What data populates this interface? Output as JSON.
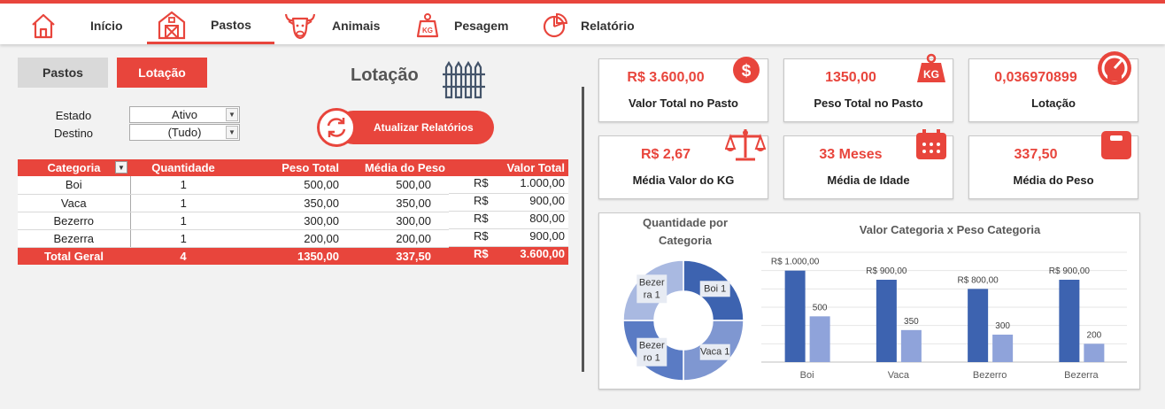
{
  "nav": {
    "items": [
      {
        "label": "Início"
      },
      {
        "label": "Pastos"
      },
      {
        "label": "Animais"
      },
      {
        "label": "Pesagem"
      },
      {
        "label": "Relatório"
      }
    ]
  },
  "buttons": {
    "pastos": "Pastos",
    "lotacao": "Lotação",
    "atualizar": "Atualizar Relatórios"
  },
  "section_title": "Lotação",
  "filters": {
    "estado_label": "Estado",
    "estado_value": "Ativo",
    "destino_label": "Destino",
    "destino_value": "(Tudo)"
  },
  "table": {
    "headers": [
      "Categoria",
      "Quantidade",
      "Peso Total",
      "Média do Peso",
      "Valor Total"
    ],
    "rows": [
      {
        "categoria": "Boi",
        "quantidade": "1",
        "peso": "500,00",
        "media": "500,00",
        "cur": "R$",
        "valor": "1.000,00"
      },
      {
        "categoria": "Vaca",
        "quantidade": "1",
        "peso": "350,00",
        "media": "350,00",
        "cur": "R$",
        "valor": "900,00"
      },
      {
        "categoria": "Bezerro",
        "quantidade": "1",
        "peso": "300,00",
        "media": "300,00",
        "cur": "R$",
        "valor": "800,00"
      },
      {
        "categoria": "Bezerra",
        "quantidade": "1",
        "peso": "200,00",
        "media": "200,00",
        "cur": "R$",
        "valor": "900,00"
      }
    ],
    "total": {
      "categoria": "Total Geral",
      "quantidade": "4",
      "peso": "1350,00",
      "media": "337,50",
      "cur": "R$",
      "valor": "3.600,00"
    }
  },
  "kpis": [
    {
      "value": "R$ 3.600,00",
      "label": "Valor Total no Pasto",
      "icon": "dollar-icon"
    },
    {
      "value": "1350,00",
      "label": "Peso Total no Pasto",
      "icon": "kg-weight-icon"
    },
    {
      "value": "0,036970899",
      "label": "Lotação",
      "icon": "gauge-icon"
    },
    {
      "value": "R$ 2,67",
      "label": "Média Valor do KG",
      "icon": "scale-icon"
    },
    {
      "value": "33 Meses",
      "label": "Média de Idade",
      "icon": "calendar-icon"
    },
    {
      "value": "337,50",
      "label": "Média do Peso",
      "icon": "weight-icon"
    }
  ],
  "colors": {
    "accent": "#e8453c",
    "pie": [
      "#3d63b0",
      "#7f97d1",
      "#5a7bc4",
      "#a9b9e1"
    ],
    "bar_value": "#3d63b0",
    "bar_weight": "#8fa3da"
  },
  "chart_data": [
    {
      "type": "pie",
      "title": "Quantidade por Categoria",
      "categories": [
        "Boi",
        "Vaca",
        "Bezerro",
        "Bezerra"
      ],
      "values": [
        1,
        1,
        1,
        1
      ],
      "labels": [
        "Boi 1",
        "Vaca 1",
        "Bezerro 1",
        "Bezerra 1"
      ]
    },
    {
      "type": "bar",
      "title": "Valor Categoria x Peso Categoria",
      "categories": [
        "Boi",
        "Vaca",
        "Bezerro",
        "Bezerra"
      ],
      "series": [
        {
          "values": [
            1000,
            900,
            800,
            900
          ],
          "data_labels": [
            "R$ 1.000,00",
            "R$ 900,00",
            "R$ 800,00",
            "R$ 900,00"
          ]
        },
        {
          "values": [
            500,
            350,
            300,
            200
          ],
          "data_labels": [
            "500",
            "350",
            "300",
            "200"
          ]
        }
      ],
      "ylim": [
        0,
        1200
      ],
      "grid": true
    }
  ]
}
